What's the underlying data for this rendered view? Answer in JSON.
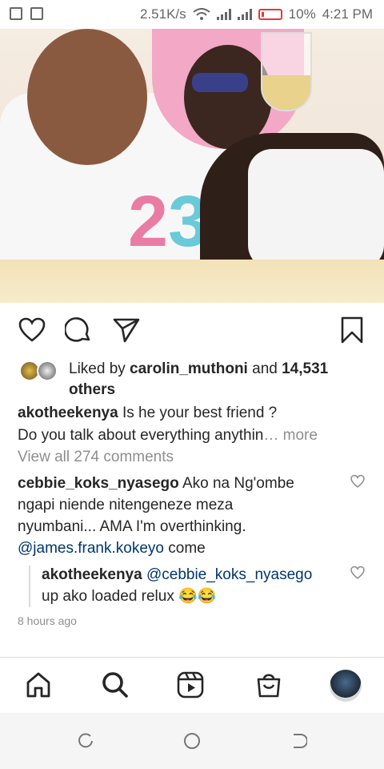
{
  "status_bar": {
    "network_speed": "2.51K/s",
    "battery": "10%",
    "time": "4:21 PM"
  },
  "post": {
    "liked_by_prefix": "Liked by ",
    "liked_by_user": "carolin_muthoni",
    "liked_by_and": " and ",
    "liked_by_count": "14,531",
    "liked_by_suffix": "others",
    "caption_user": "akotheekenya",
    "caption_text_1": " Is he your best friend ?",
    "caption_text_2": "Do you talk about everything anythin",
    "caption_more": "… more",
    "view_all_comments": "View all 274 comments",
    "comment_user": "cebbie_koks_nyasego",
    "comment_text_1": " Ako  na Ng'ombe",
    "comment_text_2": "ngapi niende nitengeneze meza",
    "comment_text_3": "nyumbani... AMA I'm overthinking.",
    "comment_mention": "@james.frank.kokeyo",
    "comment_text_4": "  come",
    "reply_user": "akotheekenya",
    "reply_mention": " @cebbie_koks_nyasego",
    "reply_text": "up ako loaded relux 😂😂",
    "timestamp": "8 hours ago"
  },
  "icons": {
    "like": "heart-icon",
    "comment": "comment-icon",
    "share": "send-icon",
    "save": "bookmark-icon",
    "nav_home": "home-icon",
    "nav_search": "search-icon",
    "nav_reels": "reels-icon",
    "nav_shop": "shop-icon"
  },
  "colors": {
    "text": "#262626",
    "secondary": "#8e8e8e",
    "mention": "#00376b",
    "battery_low": "#e53935"
  }
}
